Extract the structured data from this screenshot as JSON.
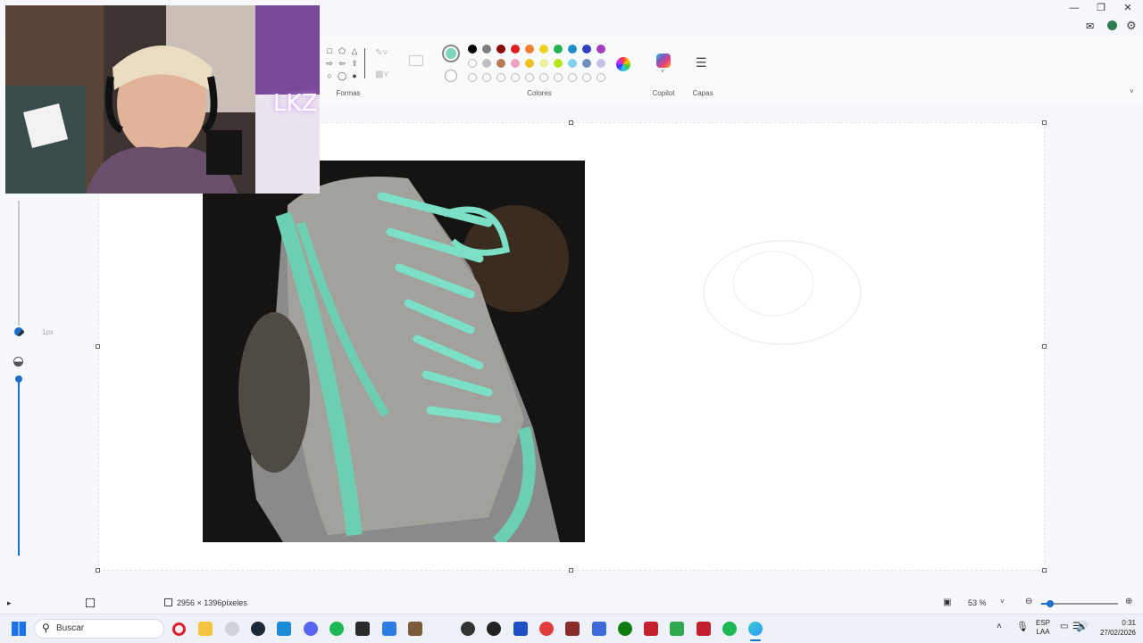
{
  "ribbon": {
    "groups": {
      "shapes_label": "Formas",
      "colors_label": "Colores",
      "copilot_label": "Copilot",
      "layers_label": "Capas"
    },
    "colors": {
      "selected": "#7fd6bd",
      "row1": [
        "#000000",
        "#7f7f7f",
        "#8b0000",
        "#e02020",
        "#f08030",
        "#f0d020",
        "#22b14c",
        "#1e90c8",
        "#3040c0",
        "#a040c0"
      ],
      "row2": [
        "empty",
        "#c0c0c0",
        "#b97a57",
        "#f0a0c0",
        "#f0c020",
        "#eef0a0",
        "#b5e61d",
        "#80d0f0",
        "#7090c0",
        "#c8bfe7"
      ],
      "row3": [
        "empty",
        "empty",
        "empty",
        "empty",
        "empty",
        "empty",
        "empty",
        "empty",
        "empty",
        "empty"
      ]
    }
  },
  "left_panel": {
    "brush_size": "1px"
  },
  "status": {
    "dimensions": "2956 × 1396píxeles",
    "zoom": "53 %"
  },
  "taskbar": {
    "search_placeholder": "Buscar",
    "lang": "ESP",
    "lang_sub": "LAA",
    "time": "0:31",
    "date": "27/02/2026",
    "webcam_sign": "LKZ"
  }
}
